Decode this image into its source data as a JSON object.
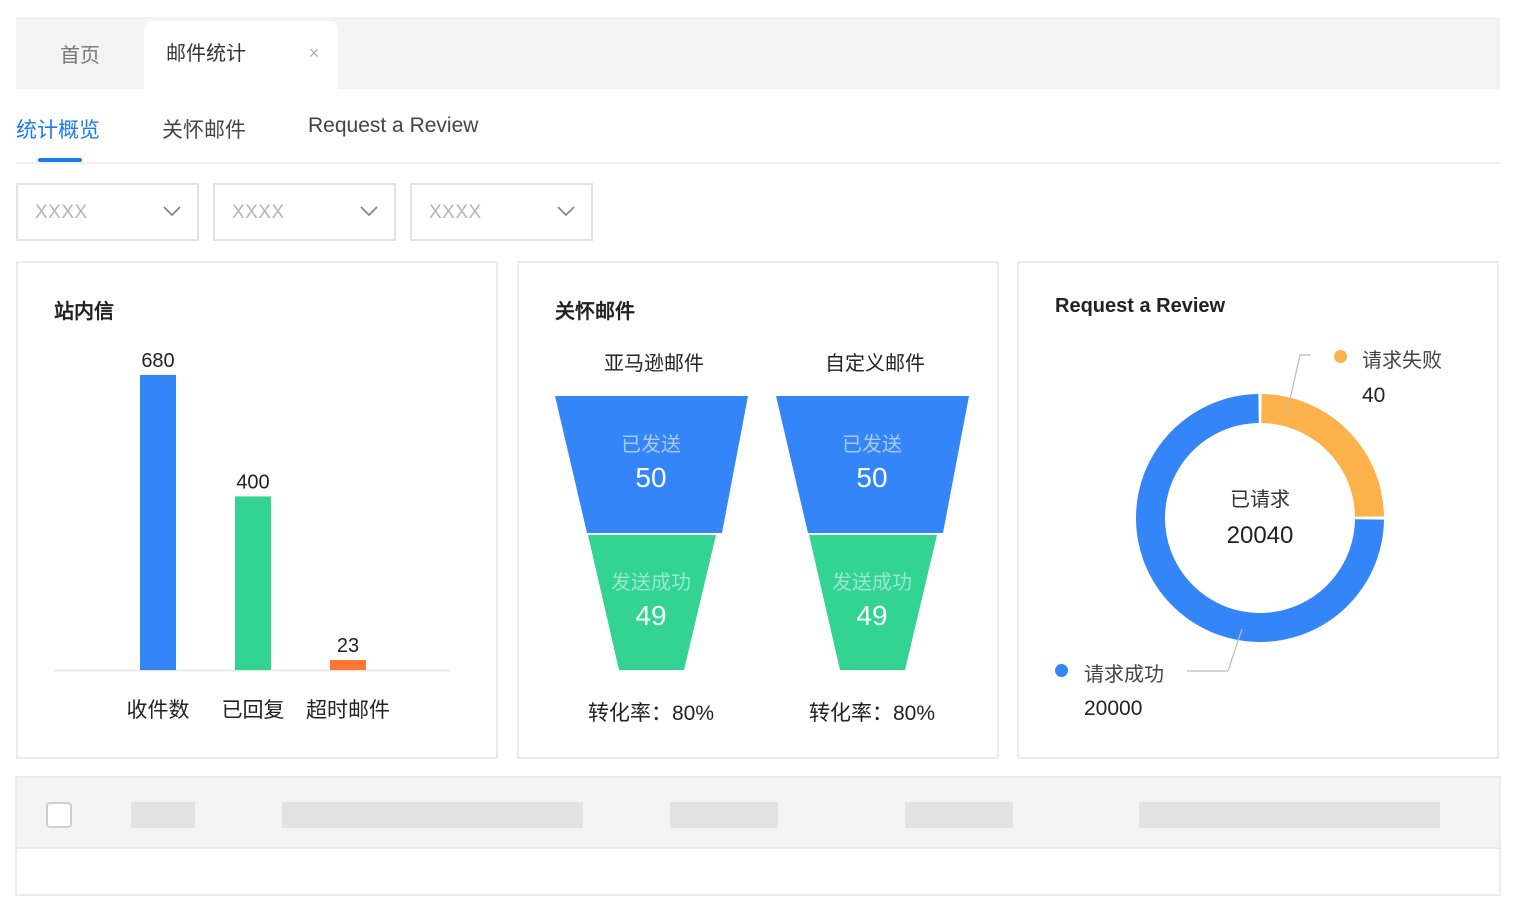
{
  "tabs": {
    "home_label": "首页",
    "active_label": "邮件统计",
    "close_symbol": "×"
  },
  "subtabs": [
    {
      "label": "统计概览",
      "active": true
    },
    {
      "label": "关怀邮件",
      "active": false
    },
    {
      "label": "Request a Review",
      "active": false
    }
  ],
  "filters": [
    {
      "value": "XXXX"
    },
    {
      "value": "XXXX"
    },
    {
      "value": "XXXX"
    }
  ],
  "inbox_card": {
    "title": "站内信",
    "chart_data": {
      "type": "bar",
      "categories": [
        "收件数",
        "已回复",
        "超时邮件"
      ],
      "values": [
        680,
        400,
        23
      ],
      "colors": [
        "#3485f7",
        "#32d393",
        "#ff7733"
      ],
      "ylim": [
        0,
        680
      ]
    }
  },
  "care_card": {
    "title": "关怀邮件",
    "funnels": [
      {
        "name": "亚马逊邮件",
        "stages": [
          {
            "label": "已发送",
            "value": "50"
          },
          {
            "label": "发送成功",
            "value": "49"
          }
        ],
        "conversion": "转化率：80%"
      },
      {
        "name": "自定义邮件",
        "stages": [
          {
            "label": "已发送",
            "value": "50"
          },
          {
            "label": "发送成功",
            "value": "49"
          }
        ],
        "conversion": "转化率：80%"
      }
    ],
    "colors": {
      "top": "#3485f7",
      "bottom": "#32d393"
    }
  },
  "review_card": {
    "title": "Request a Review",
    "center_label": "已请求",
    "center_value": "20040",
    "chart_data": {
      "type": "pie",
      "donut": true,
      "slices": [
        {
          "name": "请求成功",
          "value": 20000,
          "display": "20000",
          "color": "#3485f7"
        },
        {
          "name": "请求失败",
          "value": 40,
          "display": "40",
          "color": "#fbb24b"
        }
      ]
    }
  },
  "table": {
    "select_all_checked": false
  }
}
